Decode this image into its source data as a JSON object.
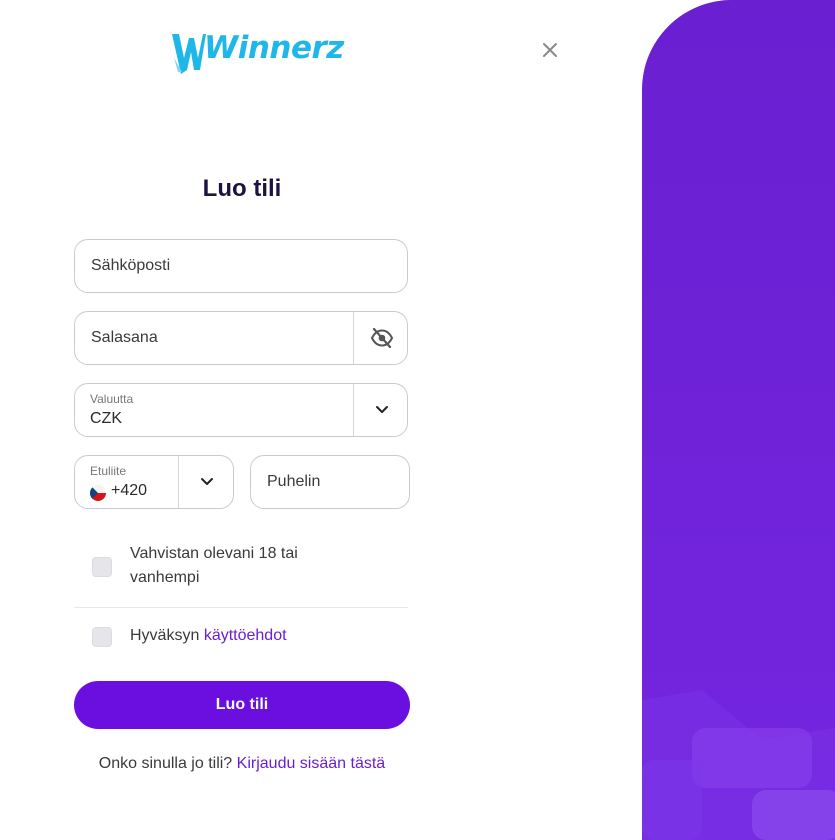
{
  "brand": {
    "name": "Winnerz",
    "accent": "#6a0fe0",
    "logo_color": "#1fb6e8"
  },
  "dialog": {
    "close_icon": "close-icon",
    "title": "Luo tili"
  },
  "form": {
    "email": {
      "placeholder": "Sähköposti",
      "value": ""
    },
    "password": {
      "placeholder": "Salasana",
      "value": "",
      "toggle_icon": "eye-off-icon"
    },
    "currency": {
      "label": "Valuutta",
      "value": "CZK"
    },
    "prefix": {
      "label": "Etuliite",
      "value": "+420",
      "flag_icon": "czech-flag-icon"
    },
    "phone": {
      "placeholder": "Puhelin",
      "value": ""
    },
    "age_check": {
      "label": "Vahvistan olevani 18 tai vanhempi",
      "checked": false
    },
    "terms_check": {
      "label_prefix": "Hyväksyn",
      "link_text": "käyttöehdot",
      "checked": false
    },
    "submit_label": "Luo tili"
  },
  "footer": {
    "question": "Onko sinulla jo tili?",
    "login_link": "Kirjaudu sisään tästä"
  }
}
